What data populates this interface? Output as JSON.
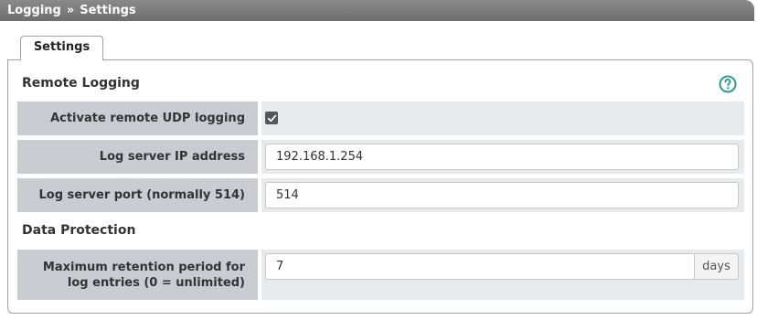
{
  "breadcrumb": {
    "part1": "Logging",
    "separator": "»",
    "part2": "Settings"
  },
  "tabs": [
    {
      "label": "Settings"
    }
  ],
  "sections": {
    "remote_logging": {
      "title": "Remote Logging",
      "activate_label": "Activate remote UDP logging",
      "activate_checked": true,
      "ip_label": "Log server IP address",
      "ip_value": "192.168.1.254",
      "port_label": "Log server port (normally 514)",
      "port_value": "514"
    },
    "data_protection": {
      "title": "Data Protection",
      "retention_label": "Maximum retention period for log entries (0 = unlimited)",
      "retention_value": "7",
      "retention_unit": "days"
    }
  },
  "icons": {
    "help": "help-circle-icon",
    "check": "checkmark-icon"
  },
  "colors": {
    "accent": "#2a9d8f",
    "label_bg": "#c9cdd1",
    "value_bg": "#e8eaec",
    "titlebar": "#7a7a7a"
  }
}
